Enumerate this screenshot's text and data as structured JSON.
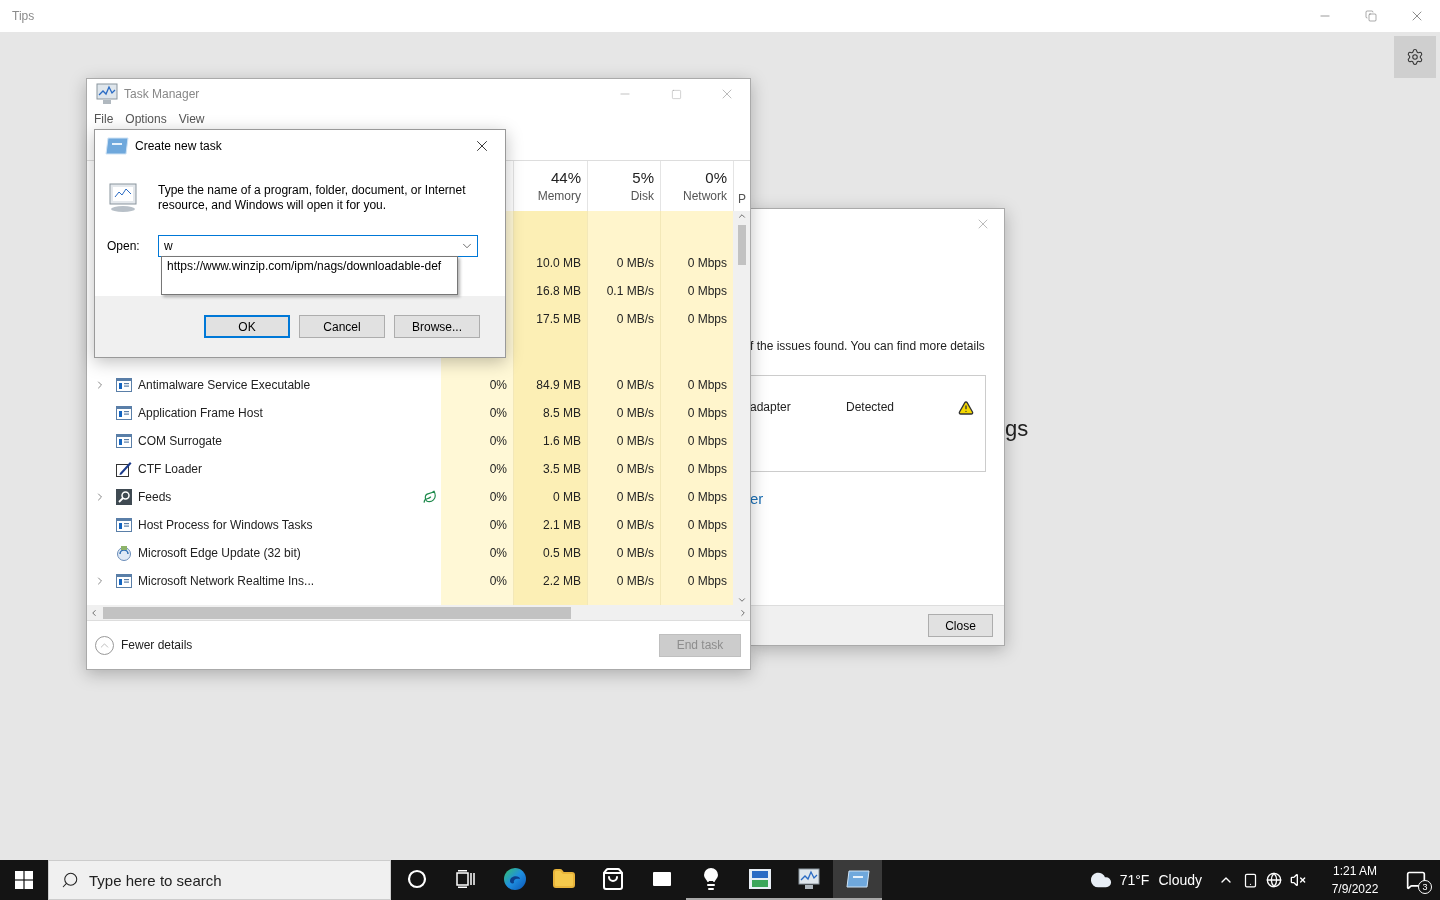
{
  "tips_window": {
    "title": "Tips",
    "background_text": "gs"
  },
  "troubleshooter": {
    "description": "f the issues found. You can find more details",
    "issue": {
      "name": "adapter",
      "status": "Detected"
    },
    "link": "er",
    "button": "Close"
  },
  "task_manager": {
    "title": "Task Manager",
    "menu": [
      "File",
      "Options",
      "View"
    ],
    "columns": [
      {
        "percent": "44%",
        "label": "Memory"
      },
      {
        "percent": "5%",
        "label": "Disk"
      },
      {
        "percent": "0%",
        "label": "Network"
      }
    ],
    "cut_column": "P",
    "top_rows": [
      {
        "memory": "10.0 MB",
        "disk": "0 MB/s",
        "network": "0 Mbps"
      },
      {
        "memory": "16.8 MB",
        "disk": "0.1 MB/s",
        "network": "0 Mbps"
      },
      {
        "memory": "17.5 MB",
        "disk": "0 MB/s",
        "network": "0 Mbps"
      }
    ],
    "processes": [
      {
        "name": "Antimalware Service Executable",
        "expandable": true,
        "kind": "window",
        "eco_leaf": false,
        "cpu": "0%",
        "memory": "84.9 MB",
        "disk": "0 MB/s",
        "network": "0 Mbps"
      },
      {
        "name": "Application Frame Host",
        "expandable": false,
        "kind": "window",
        "eco_leaf": false,
        "cpu": "0%",
        "memory": "8.5 MB",
        "disk": "0 MB/s",
        "network": "0 Mbps"
      },
      {
        "name": "COM Surrogate",
        "expandable": false,
        "kind": "window",
        "eco_leaf": false,
        "cpu": "0%",
        "memory": "1.6 MB",
        "disk": "0 MB/s",
        "network": "0 Mbps"
      },
      {
        "name": "CTF Loader",
        "expandable": false,
        "kind": "pen",
        "eco_leaf": false,
        "cpu": "0%",
        "memory": "3.5 MB",
        "disk": "0 MB/s",
        "network": "0 Mbps"
      },
      {
        "name": "Feeds",
        "expandable": true,
        "kind": "search",
        "eco_leaf": true,
        "cpu": "0%",
        "memory": "0 MB",
        "disk": "0 MB/s",
        "network": "0 Mbps"
      },
      {
        "name": "Host Process for Windows Tasks",
        "expandable": false,
        "kind": "window",
        "eco_leaf": false,
        "cpu": "0%",
        "memory": "2.1 MB",
        "disk": "0 MB/s",
        "network": "0 Mbps"
      },
      {
        "name": "Microsoft Edge Update (32 bit)",
        "expandable": false,
        "kind": "update",
        "eco_leaf": false,
        "cpu": "0%",
        "memory": "0.5 MB",
        "disk": "0 MB/s",
        "network": "0 Mbps"
      },
      {
        "name": "Microsoft Network Realtime Ins...",
        "expandable": true,
        "kind": "window",
        "eco_leaf": false,
        "cpu": "0%",
        "memory": "2.2 MB",
        "disk": "0 MB/s",
        "network": "0 Mbps"
      }
    ],
    "footer": {
      "toggle": "Fewer details",
      "end_task": {
        "label": "End task",
        "disabled": true
      }
    }
  },
  "run_dialog": {
    "title": "Create new task",
    "description": "Type the name of a program, folder, document, or Internet resource, and Windows will open it for you.",
    "open_label": "Open:",
    "value": "w",
    "suggestion": "https://www.winzip.com/ipm/nags/downloadable-def",
    "buttons": [
      {
        "label": "OK",
        "default": true
      },
      {
        "label": "Cancel",
        "default": false
      },
      {
        "label": "Browse...",
        "default": false
      }
    ]
  },
  "taskbar": {
    "search_placeholder": "Type here to search",
    "apps": [
      {
        "kind": "cortana",
        "running": false,
        "selected": false
      },
      {
        "kind": "task-view",
        "running": false,
        "selected": false
      },
      {
        "kind": "edge",
        "running": false,
        "selected": false
      },
      {
        "kind": "explorer",
        "running": false,
        "selected": false
      },
      {
        "kind": "store",
        "running": false,
        "selected": false
      },
      {
        "kind": "mail",
        "running": false,
        "selected": false
      },
      {
        "kind": "tips",
        "running": true,
        "selected": false
      },
      {
        "kind": "remote",
        "running": true,
        "selected": false
      },
      {
        "kind": "task-manager",
        "running": true,
        "selected": false
      },
      {
        "kind": "run",
        "running": true,
        "selected": true
      }
    ],
    "temperature": "71°F",
    "weather": "Cloudy",
    "time": "1:21 AM",
    "date": "7/9/2022",
    "notifications": "3"
  }
}
